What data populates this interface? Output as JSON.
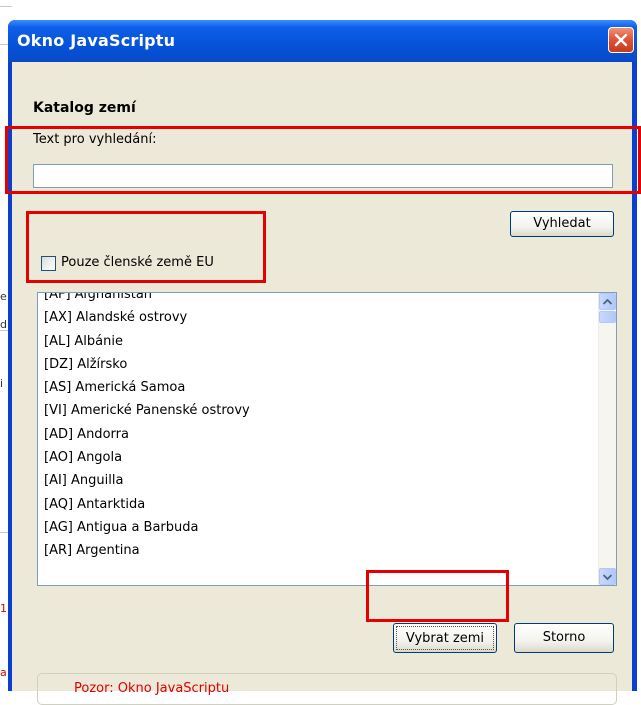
{
  "window": {
    "title": "Okno JavaScriptu"
  },
  "dialog": {
    "section_title": "Katalog zemí",
    "search_label": "Text pro vyhledání:",
    "search_value": "",
    "search_button": "Vyhledat",
    "eu_only_label": "Pouze členské země EU",
    "eu_only_checked": false,
    "countries": [
      "[AF] Afghánistán",
      "[AX] Alandské ostrovy",
      "[AL] Albánie",
      "[DZ] Alžírsko",
      "[AS] Americká Samoa",
      "[VI] Americké Panenské ostrovy",
      "[AD] Andorra",
      "[AO] Angola",
      "[AI] Anguilla",
      "[AQ] Antarktida",
      "[AG] Antigua a Barbuda",
      "[AR] Argentina"
    ],
    "select_button": "Vybrat zemi",
    "cancel_button": "Storno",
    "status_text": "Pozor: Okno JavaScriptu"
  },
  "background": {
    "fragments": [
      "e",
      "d",
      "i",
      "1",
      "a"
    ]
  },
  "icons": {
    "close": "close-icon",
    "scroll_up": "chevron-up-icon",
    "scroll_down": "chevron-down-icon"
  },
  "colors": {
    "titlebar": "#0553d8",
    "client": "#ece9d8",
    "annotation": "#e60000",
    "status_text": "#e00000"
  }
}
